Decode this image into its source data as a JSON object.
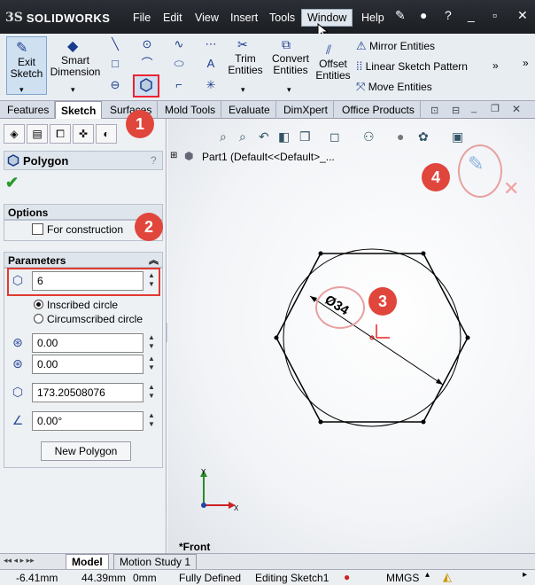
{
  "app": {
    "logo_prefix": "3S",
    "logo_name": "SOLIDWORKS"
  },
  "menu": [
    "File",
    "Edit",
    "View",
    "Insert",
    "Tools",
    "Window",
    "Help"
  ],
  "toolbar": {
    "exit_sketch": "Exit Sketch",
    "smart_dimension": "Smart Dimension",
    "trim_entities": "Trim Entities",
    "convert_entities": "Convert Entities",
    "offset_entities": "Offset Entities",
    "mirror_entities": "Mirror Entities",
    "linear_sketch_pattern": "Linear Sketch Pattern",
    "move_entities": "Move Entities"
  },
  "tabs": [
    "Features",
    "Sketch",
    "Surfaces",
    "Mold Tools",
    "Evaluate",
    "DimXpert",
    "Office Products"
  ],
  "active_tab": "Sketch",
  "property_manager": {
    "title": "Polygon",
    "help": "?",
    "options_label": "Options",
    "for_construction": "For construction",
    "parameters_label": "Parameters",
    "sides": "6",
    "inscribed": "Inscribed circle",
    "circumscribed": "Circumscribed circle",
    "center_x": "0.00",
    "center_y": "0.00",
    "diameter": "173.20508076",
    "angle": "0.00°",
    "new_polygon": "New Polygon"
  },
  "tree": {
    "part": "Part1  (Default<<Default>_..."
  },
  "dimension": "Ø34",
  "view_label": "*Front",
  "bottom_tabs": [
    "Model",
    "Motion Study 1"
  ],
  "status": {
    "x": "-6.41mm",
    "y": "44.39mm",
    "z": "0mm",
    "state": "Fully Defined",
    "editing": "Editing Sketch1",
    "units": "MMGS"
  },
  "callouts": [
    "1",
    "2",
    "3",
    "4"
  ],
  "colors": {
    "highlight": "#e23a32",
    "callout": "#e0463c",
    "title_bg": "#23272d"
  }
}
